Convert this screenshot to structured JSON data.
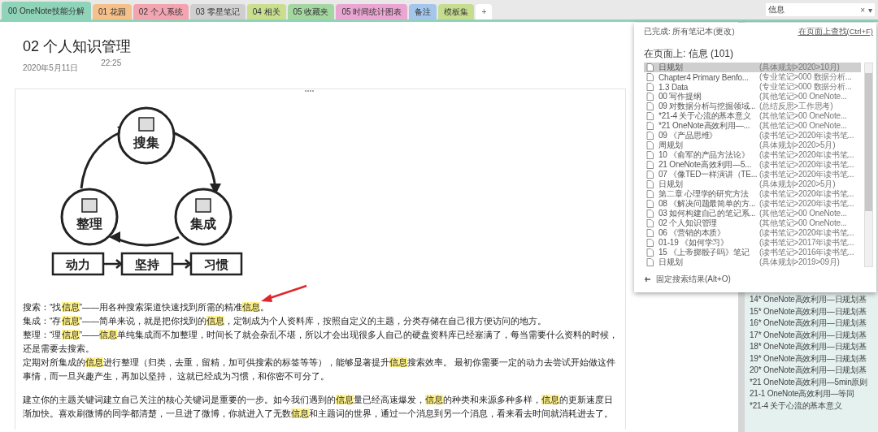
{
  "tabs": [
    {
      "label": "00 OneNote技能分解",
      "color": "#8fd3b8",
      "selected": true
    },
    {
      "label": "01 花园",
      "color": "#f5c08a",
      "selected": false
    },
    {
      "label": "02 个人系统",
      "color": "#f2a5b0",
      "selected": false
    },
    {
      "label": "03 零星笔记",
      "color": "#cfcfcf",
      "selected": false
    },
    {
      "label": "04 相关",
      "color": "#c9de8f",
      "selected": false
    },
    {
      "label": "05 收藏夹",
      "color": "#a3d6a0",
      "selected": false
    },
    {
      "label": "05 时间统计图表",
      "color": "#eaa6d2",
      "selected": false
    },
    {
      "label": "备注",
      "color": "#a3c6ea",
      "selected": false
    },
    {
      "label": "模板集",
      "color": "#c6dd90",
      "selected": false
    }
  ],
  "add_tab": "+",
  "search": {
    "value": "信息",
    "clear": "×",
    "dropdown": "▾"
  },
  "page": {
    "title": "02 个人知识管理",
    "date": "2020年5月11日",
    "time": "22:25",
    "diagram": {
      "nodes": [
        {
          "label": "搜集"
        },
        {
          "label": "整理"
        },
        {
          "label": "集成"
        }
      ],
      "steps": [
        {
          "label": "动力"
        },
        {
          "label": "坚持"
        },
        {
          "label": "习惯"
        }
      ]
    },
    "paragraphs": [
      {
        "segments": [
          {
            "text": "搜索：“找",
            "highlight": false
          },
          {
            "text": "信息",
            "highlight": true
          },
          {
            "text": "”——用各种搜索渠道快速找到所需的精准",
            "highlight": false
          },
          {
            "text": "信息",
            "highlight": true
          },
          {
            "text": "。",
            "highlight": false
          }
        ]
      },
      {
        "segments": [
          {
            "text": "集成：“存",
            "highlight": false
          },
          {
            "text": "信息",
            "highlight": true
          },
          {
            "text": "”——简单来说，就是把你找到的",
            "highlight": false
          },
          {
            "text": "信息",
            "highlight": true
          },
          {
            "text": "，定制成为个人资料库，按照自定义的主题，分类存储在自己很方便访问的地方。",
            "highlight": false
          }
        ]
      },
      {
        "segments": [
          {
            "text": " 整理：“理",
            "highlight": false
          },
          {
            "text": "信息",
            "highlight": true
          },
          {
            "text": "”——",
            "highlight": false
          },
          {
            "text": "信息",
            "highlight": true
          },
          {
            "text": "单纯集成而不加整理，时间长了就会杂乱不堪，所以才会出现很多人自己的硬盘资料库已经塞满了，每当需要什么资料的时候，还是需要去搜索。",
            "highlight": false
          }
        ]
      },
      {
        "segments": [
          {
            "text": "定期对所集成的",
            "highlight": false
          },
          {
            "text": "信息",
            "highlight": true
          },
          {
            "text": "进行整理（归类，去重，留精，加可供搜索的标签等等），能够显著提升",
            "highlight": false
          },
          {
            "text": "信息",
            "highlight": true
          },
          {
            "text": "搜索效率。 最初你需要一定的动力去尝试开始做这件事情，而一旦兴趣产生，再加以坚持， 这就已经成为习惯，和你密不可分了。",
            "highlight": false
          }
        ]
      },
      {
        "segments": [
          {
            "text": "建立你的主题关键词建立自己关注的核心关键词是重要的一步。如今我们遇到的",
            "highlight": false
          },
          {
            "text": "信息",
            "highlight": true
          },
          {
            "text": "量已经高速爆发，",
            "highlight": false
          },
          {
            "text": "信息",
            "highlight": true
          },
          {
            "text": "的种类和来源多种多样，",
            "highlight": false
          },
          {
            "text": "信息",
            "highlight": true
          },
          {
            "text": "的更新速度日渐加快。喜欢刷微博的同学都清楚，一旦进了微博，你就进入了无数",
            "highlight": false
          },
          {
            "text": "信息",
            "highlight": true
          },
          {
            "text": "和主题词的世界，通过一个消息到另一个消息，看来看去时间就消耗进去了。",
            "highlight": false
          }
        ]
      }
    ]
  },
  "results": {
    "scope": "已完成: 所有笔记本(更改)",
    "find_on_page": "在页面上查找(Ctrl+F)",
    "heading": "在页面上: 信息 (101)",
    "rows": [
      {
        "title": "日规划",
        "path": "(具体规划>2020>10月)",
        "selected": true
      },
      {
        "title": "Chapter4 Primary Benfo...",
        "path": "(专业笔记>000 数据分析...",
        "selected": false
      },
      {
        "title": "1.3 Data",
        "path": "(专业笔记>000 数据分析...",
        "selected": false
      },
      {
        "title": "00 写作提纲",
        "path": "(其他笔记>00 OneNote...",
        "selected": false
      },
      {
        "title": "09 对数据分析与挖掘领域...",
        "path": "(总结反思>工作思考)",
        "selected": false
      },
      {
        "title": "*21-4  关于心流的基本意义",
        "path": "(其他笔记>00 OneNote...",
        "selected": false
      },
      {
        "title": "*21 OneNote高效利用—...",
        "path": "(其他笔记>00 OneNote...",
        "selected": false
      },
      {
        "title": "09 《产品思维》",
        "path": "(读书笔记>2020年读书笔...",
        "selected": false
      },
      {
        "title": "周规划",
        "path": "(具体规划>2020>5月)",
        "selected": false
      },
      {
        "title": "10 《俞军的产品方法论》",
        "path": "(读书笔记>2020年读书笔...",
        "selected": false
      },
      {
        "title": "21 OneNote高效利用—5...",
        "path": "(读书笔记>2020年读书笔...",
        "selected": false
      },
      {
        "title": "07 《像TED一样演讲（TE...",
        "path": "(读书笔记>2020年读书笔...",
        "selected": false
      },
      {
        "title": "日规划",
        "path": "(具体规划>2020>5月)",
        "selected": false
      },
      {
        "title": "第二章 心理学的研究方法",
        "path": "(读书笔记>2020年读书笔...",
        "selected": false
      },
      {
        "title": "08 《解决问题最简单的方...",
        "path": "(读书笔记>2020年读书笔...",
        "selected": false
      },
      {
        "title": "03 如何构建自己的笔记系...",
        "path": "(其他笔记>00 OneNote...",
        "selected": false
      },
      {
        "title": "02 个人知识管理",
        "path": "(其他笔记>00 OneNote...",
        "selected": false
      },
      {
        "title": "06 《营销的本质》",
        "path": "(读书笔记>2020年读书笔...",
        "selected": false
      },
      {
        "title": "01-19 《如何学习》",
        "path": "(读书笔记>2017年读书笔...",
        "selected": false
      },
      {
        "title": "15 《上帝掷骰子吗》笔记",
        "path": "(读书笔记>2016年读书笔...",
        "selected": false
      },
      {
        "title": "日规划",
        "path": "(具体规划>2019>09月)",
        "selected": false
      }
    ],
    "pin": "固定搜索结果(Alt+O)"
  },
  "pages": [
    {
      "title": "14* OneNote高效利用—日规划基"
    },
    {
      "title": "15* OneNote高效利用—日规划基"
    },
    {
      "title": "16* OneNote高效利用—日规划基"
    },
    {
      "title": "17* OneNote高效利用—日规划基"
    },
    {
      "title": "18*  OneNote高效利用—日规划基"
    },
    {
      "title": "19* OneNote高效利用—日规划基"
    },
    {
      "title": "20* OneNote高效利用—日规划基"
    },
    {
      "title": "*21 OneNote高效利用—5min原则"
    },
    {
      "title": "21-1 OneNote高效利用—等同"
    },
    {
      "title": "*21-4  关于心流的基本意义"
    }
  ]
}
